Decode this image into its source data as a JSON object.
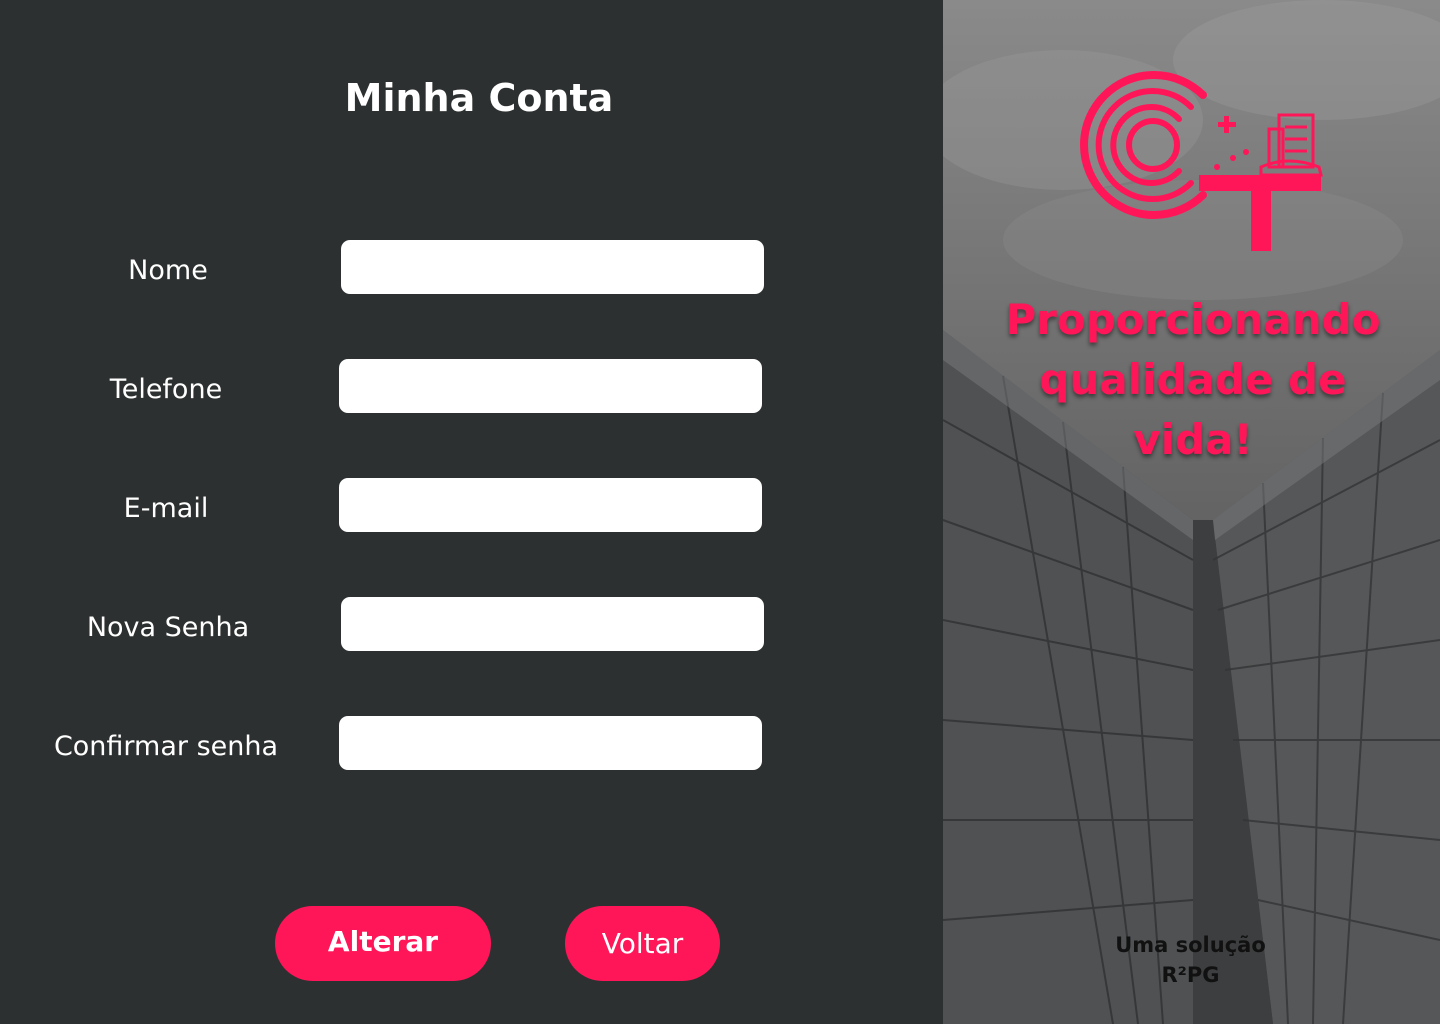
{
  "page_title": "Minha Conta",
  "form": {
    "fields": [
      {
        "label": "Nome",
        "value": ""
      },
      {
        "label": "Telefone",
        "value": ""
      },
      {
        "label": "E-mail",
        "value": ""
      },
      {
        "label": "Nova Senha",
        "value": ""
      },
      {
        "label": "Confirmar senha",
        "value": ""
      }
    ]
  },
  "buttons": {
    "alterar": "Alterar",
    "voltar": "Voltar"
  },
  "brand": {
    "tagline": "Proporcionando qualidade de vida!",
    "credit_line1": "Uma solução",
    "credit_line2": "R²PG",
    "logo_icon": "ct-logo-icon"
  },
  "colors": {
    "accent": "#ff1659",
    "panel_bg": "#2d3030",
    "input_bg": "#ffffff",
    "text": "#ffffff"
  }
}
